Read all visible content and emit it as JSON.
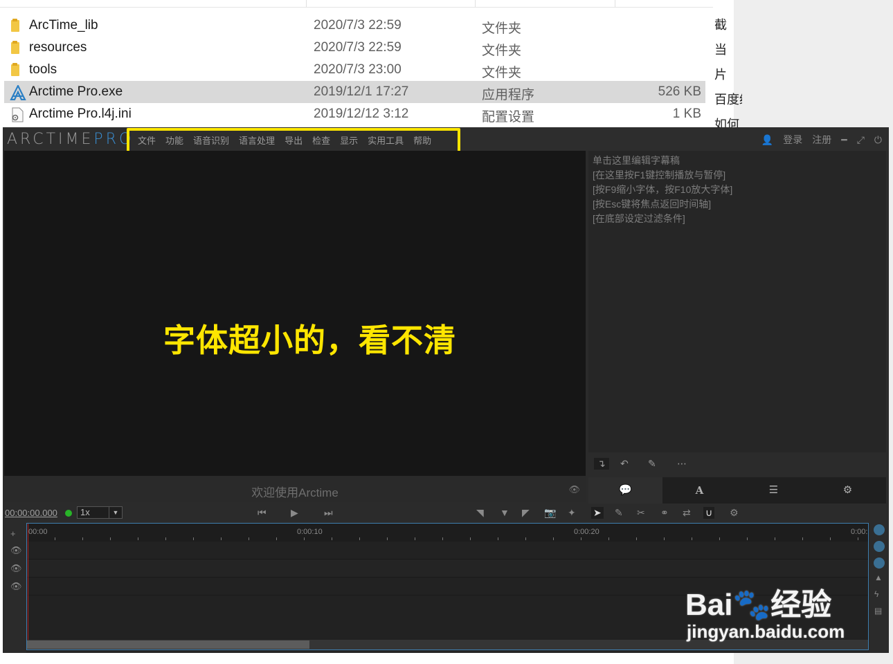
{
  "files": [
    {
      "name": "ArcTime_lib",
      "date": "2020/7/3 22:59",
      "type": "文件夹",
      "size": "",
      "icon": "folder-icon"
    },
    {
      "name": "resources",
      "date": "2020/7/3 22:59",
      "type": "文件夹",
      "size": "",
      "icon": "folder-icon"
    },
    {
      "name": "tools",
      "date": "2020/7/3 23:00",
      "type": "文件夹",
      "size": "",
      "icon": "folder-icon"
    },
    {
      "name": "Arctime Pro.exe",
      "date": "2019/12/1 17:27",
      "type": "应用程序",
      "size": "526 KB",
      "icon": "arctime-app-icon"
    },
    {
      "name": "Arctime Pro.l4j.ini",
      "date": "2019/12/12 3:12",
      "type": "配置设置",
      "size": "1 KB",
      "icon": "ini-file-icon"
    }
  ],
  "side_fragments": [
    "截",
    "当",
    "片",
    "百度经",
    "如何"
  ],
  "app": {
    "logo_main": "ARCTIME",
    "logo_pro": "PRO",
    "menu": [
      "文件",
      "功能",
      "语音识别",
      "语言处理",
      "导出",
      "检查",
      "显示",
      "实用工具",
      "帮助"
    ],
    "login": "登录",
    "register": "注册",
    "overlay": "字体超小的，看不清",
    "welcome": "欢迎使用Arctime",
    "editor_lines": [
      "单击这里编辑字幕稿",
      "[在这里按F1键控制播放与暂停]",
      "[按F9缩小字体，按F10放大字体]",
      "[按Esc键将焦点返回时间轴]",
      "[在底部设定过滤条件]"
    ],
    "timecode": "00:00:00.000",
    "speed": "1x",
    "ruler_labels": [
      "00:00",
      "0:00:10",
      "0:00:20",
      "0:00:"
    ]
  },
  "watermark": {
    "main": "Bai🐾经验",
    "sub": "jingyan.baidu.com"
  }
}
